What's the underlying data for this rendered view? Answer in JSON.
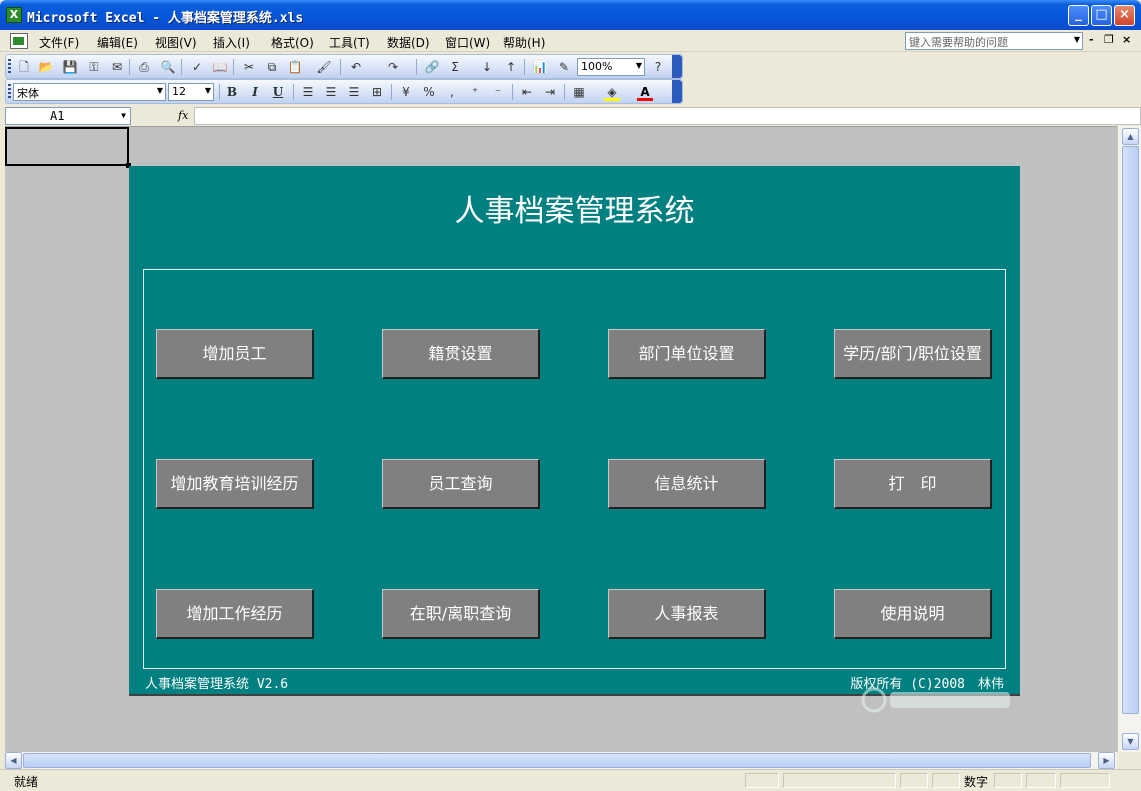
{
  "window": {
    "title": "Microsoft Excel - 人事档案管理系统.xls",
    "app_icon": "excel-icon",
    "controls": [
      "minimize",
      "maximize",
      "close"
    ]
  },
  "menu": {
    "items": [
      "文件(F)",
      "编辑(E)",
      "视图(V)",
      "插入(I)",
      "格式(O)",
      "工具(T)",
      "数据(D)",
      "窗口(W)",
      "帮助(H)"
    ],
    "help_placeholder": "键入需要帮助的问题"
  },
  "toolbar": {
    "zoom": "100%",
    "font_name": "宋体",
    "font_size": "12",
    "bold": "B",
    "italic": "I",
    "underline": "U",
    "fill_color": "#ffff00",
    "font_color": "#ff0000"
  },
  "formula_bar": {
    "cell_ref": "A1",
    "fx": "fx",
    "value": ""
  },
  "sheet": {
    "panel_color": "#008080",
    "title": "人事档案管理系统",
    "buttons": [
      [
        "增加员工",
        "籍贯设置",
        "部门单位设置",
        "学历/部门/职位设置"
      ],
      [
        "增加教育培训经历",
        "员工查询",
        "信息统计",
        "打　印"
      ],
      [
        "增加工作经历",
        "在职/离职查询",
        "人事报表",
        "使用说明"
      ]
    ],
    "footer_version": "人事档案管理系统 V2.6",
    "footer_copyright": "版权所有 (C)2008　林伟"
  },
  "status": {
    "ready": "就绪",
    "num": "数字"
  }
}
